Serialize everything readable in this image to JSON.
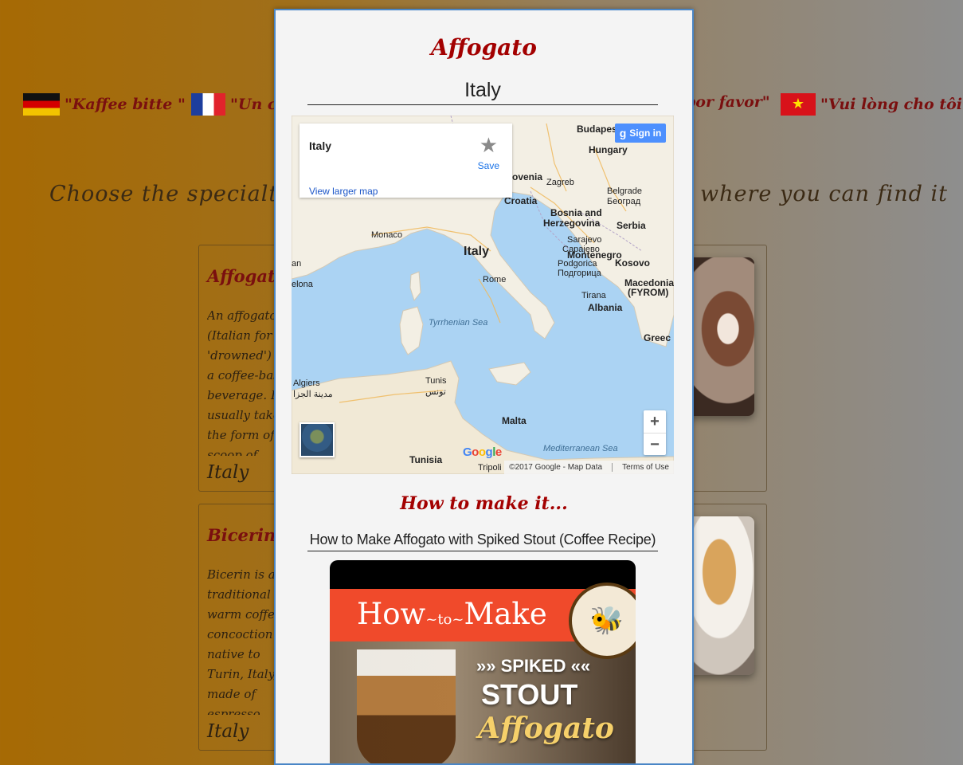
{
  "languages": [
    {
      "flag": "germany-flag",
      "text": "\"Kaffee bitte \""
    },
    {
      "flag": "france-flag",
      "text": "\"Un ca"
    },
    {
      "flag": "",
      "text": "por favor\""
    },
    {
      "flag": "vietnam-flag",
      "text": "\"Vui lòng cho tôi"
    }
  ],
  "tagline": {
    "left": "Choose the specialty cof",
    "right": "where you can find it"
  },
  "cards": [
    {
      "title": "Affogato",
      "description": "An affogato (Italian for 'drowned') is a coffee-based beverage. It usually takes the form of a scoop of vanilla gelato or ice cream topped with a shot of hot espresso. Some variations",
      "country": "Italy"
    },
    {
      "title": "Bicerin",
      "description": "Bicerin is a traditional warm coffee concoction native to Turin, Italy, made of espresso, drinking chocolate and whole milk served layered in a small rounded glass",
      "country": "Italy"
    }
  ],
  "modal": {
    "title": "Affogato",
    "country": "Italy",
    "map": {
      "place_name": "Italy",
      "save_label": "Save",
      "view_larger": "View larger map",
      "sign_in": "Sign in",
      "zoom_in": "+",
      "zoom_out": "−",
      "attribution": "©2017 Google - Map Data",
      "terms": "Terms of Use",
      "labels": {
        "budapest": "Budapest",
        "hungary": "Hungary",
        "slovenia": "ovenia",
        "zagreb": "Zagreb",
        "belgrade": "Belgrade",
        "belgrade_cyr": "Београд",
        "croatia": "Croatia",
        "serbia": "Serbia",
        "bosnia": "Bosnia and",
        "herzegovina": "Herzegovina",
        "sarajevo": "Sarajevo",
        "sarajevo_cyr": "Сарајево",
        "monaco": "Monaco",
        "italy": "Italy",
        "rome": "Rome",
        "montenegro": "Montenegro",
        "podgorica": "Podgorica",
        "podgorica_cyr": "Подгорица",
        "kosovo": "Kosovo",
        "macedonia": "Macedonia",
        "fyrom": "(FYROM)",
        "tirana": "Tirana",
        "albania": "Albania",
        "greece": "Greec",
        "barcelona": "elona",
        "tyrrhenian": "Tyrrhenian Sea",
        "algiers": "Algiers",
        "algiers_ar": "الجزائر",
        "tunis": "Tunis",
        "tunis_ar": "تونس",
        "algeria_ar": "مدينة الجزا",
        "malta": "Malta",
        "mediterranean": "Mediterranean Sea",
        "tunisia": "Tunisia",
        "tripoli": "Tripoli",
        "ana": "an"
      }
    },
    "how_to_heading": "How to make it...",
    "video": {
      "title": "How to Make Affogato with Spiked Stout (Coffee Recipe)",
      "banner_text_1": "How",
      "banner_text_2": "to",
      "banner_text_3": "Make",
      "line1": "»» SPIKED ««",
      "line2": "STOUT",
      "line3": "Affogato",
      "watermark": "MakeBees"
    }
  },
  "colors": {
    "accent": "#a30000",
    "modal_border": "#4a86c6",
    "map_water": "#abd3f3"
  }
}
